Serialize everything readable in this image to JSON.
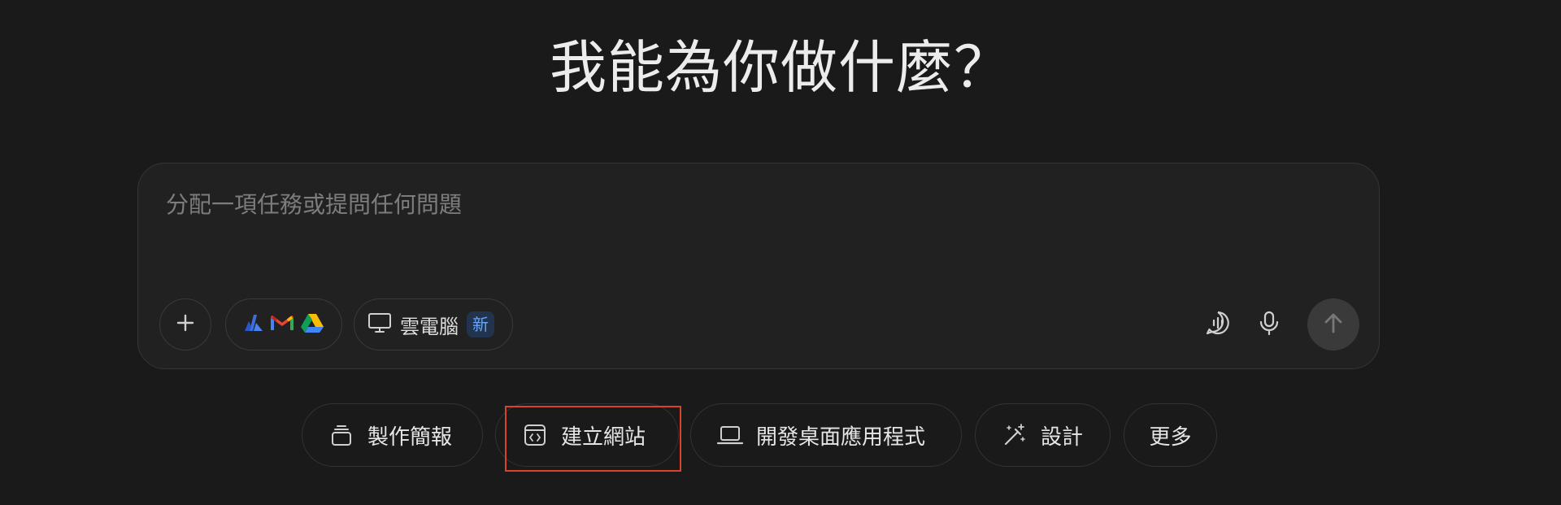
{
  "heading": "我能為你做什麼？",
  "composer": {
    "placeholder": "分配一項任務或提問任何問題",
    "value": "",
    "cloud_computer_label": "雲電腦",
    "new_badge": "新",
    "connector_icons": [
      "multi-cloud-icon",
      "gmail-icon",
      "google-drive-icon"
    ]
  },
  "quick_actions": [
    {
      "label": "製作簡報",
      "icon": "layers-icon"
    },
    {
      "label": "建立網站",
      "icon": "code-window-icon"
    },
    {
      "label": "開發桌面應用程式",
      "icon": "laptop-icon"
    },
    {
      "label": "設計",
      "icon": "magic-wand-icon"
    },
    {
      "label": "更多",
      "icon": ""
    }
  ],
  "colors": {
    "background": "#1a1a1a",
    "composer_bg": "#212121",
    "highlight": "#d9432b",
    "badge_text": "#6aa5f5"
  }
}
